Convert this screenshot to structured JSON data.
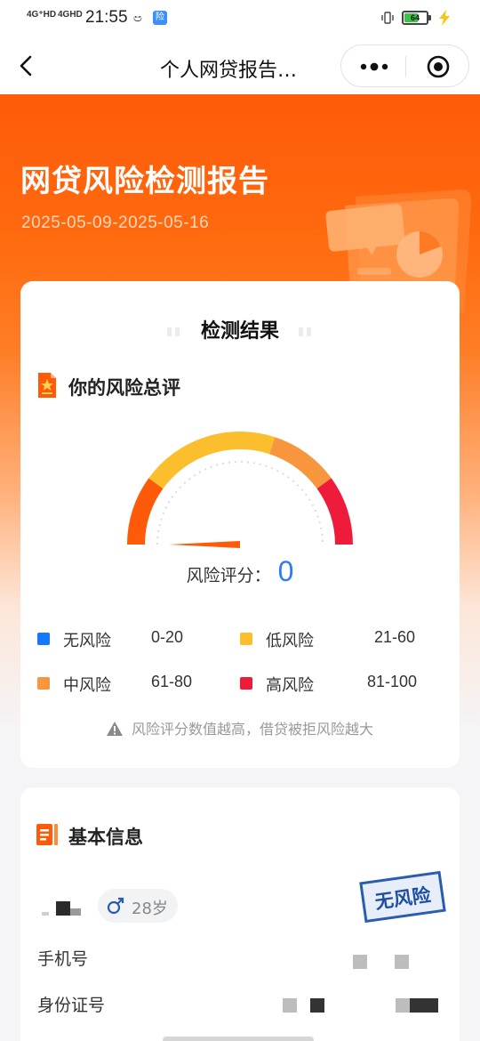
{
  "status_bar": {
    "network_1": "4G⁺HD",
    "network_2": "4GHD",
    "time": "21:55",
    "app_badge": "险",
    "battery_level": "64"
  },
  "nav": {
    "title": "个人网贷报告…"
  },
  "hero": {
    "title": "网贷风险检测报告",
    "date_range": "2025-05-09-2025-05-16"
  },
  "result": {
    "title": "检测结果",
    "section_title": "你的风险总评",
    "score_label": "风险评分：",
    "score_value": "0",
    "gauge_max": 100,
    "legend": [
      {
        "name": "无风险",
        "range": "0-20",
        "color": "#1677ff"
      },
      {
        "name": "低风险",
        "range": "21-60",
        "color": "#fbbf2d"
      },
      {
        "name": "中风险",
        "range": "61-80",
        "color": "#f7963d"
      },
      {
        "name": "高风险",
        "range": "81-100",
        "color": "#ee1c3a"
      }
    ],
    "note": "风险评分数值越高，借贷被拒风险越大"
  },
  "basic": {
    "section_title": "基本信息",
    "age": "28岁",
    "stamp": "无风险",
    "phone_label": "手机号",
    "id_label": "身份证号"
  },
  "colors": {
    "brand_orange": "#ff5a0a",
    "score_blue": "#2d7cf6"
  }
}
